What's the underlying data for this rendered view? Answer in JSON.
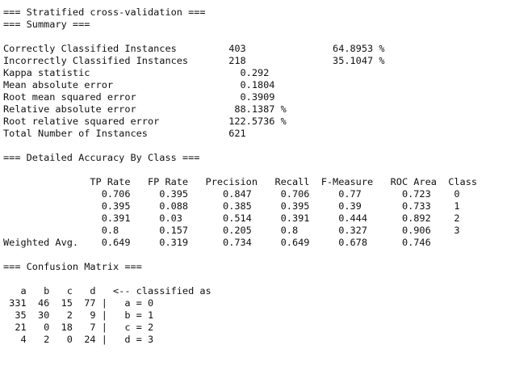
{
  "output": {
    "lines": [
      "=== Stratified cross-validation ===",
      "=== Summary ===",
      "",
      "Correctly Classified Instances         403               64.8953 %",
      "Incorrectly Classified Instances       218               35.1047 %",
      "Kappa statistic                          0.292",
      "Mean absolute error                      0.1804",
      "Root mean squared error                  0.3909",
      "Relative absolute error                 88.1387 %",
      "Root relative squared error            122.5736 %",
      "Total Number of Instances              621",
      "",
      "=== Detailed Accuracy By Class ===",
      "",
      "               TP Rate   FP Rate   Precision   Recall  F-Measure   ROC Area  Class",
      "                 0.706     0.395      0.847     0.706     0.77       0.723    0",
      "                 0.395     0.088      0.385     0.395     0.39       0.733    1",
      "                 0.391     0.03       0.514     0.391     0.444      0.892    2",
      "                 0.8       0.157      0.205     0.8       0.327      0.906    3",
      "Weighted Avg.    0.649     0.319      0.734     0.649     0.678      0.746",
      "",
      "=== Confusion Matrix ===",
      "",
      "   a   b   c   d   <-- classified as",
      " 331  46  15  77 |   a = 0",
      "  35  30   2   9 |   b = 1",
      "  21   0  18   7 |   c = 2",
      "   4   2   0  24 |   d = 3"
    ]
  }
}
